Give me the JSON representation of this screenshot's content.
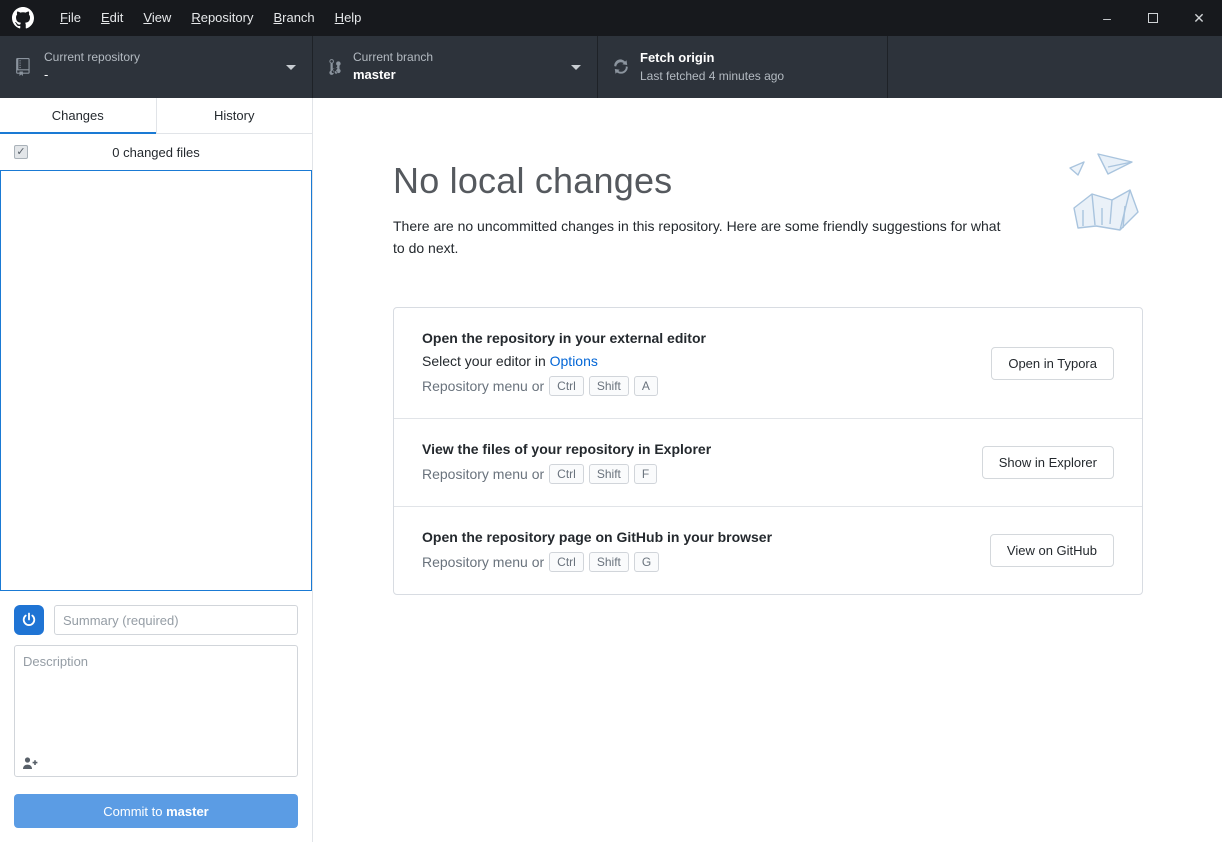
{
  "titlebar": {
    "menus": [
      "File",
      "Edit",
      "View",
      "Repository",
      "Branch",
      "Help"
    ],
    "window": {
      "minimize": "–",
      "close": "✕"
    }
  },
  "toolbar": {
    "repository": {
      "label": "Current repository",
      "value": "-"
    },
    "branch": {
      "label": "Current branch",
      "value": "master"
    },
    "fetch": {
      "title": "Fetch origin",
      "detail": "Last fetched 4 minutes ago"
    }
  },
  "sidebar": {
    "tabs": [
      {
        "label": "Changes"
      },
      {
        "label": "History"
      }
    ],
    "changed_files": "0 changed files",
    "checkbox_check": "✓",
    "summary_placeholder": "Summary (required)",
    "description_placeholder": "Description",
    "commit": {
      "prefix": "Commit to ",
      "branch": "master"
    }
  },
  "main": {
    "title": "No local changes",
    "subtitle": "There are no uncommitted changes in this repository. Here are some friendly suggestions for what to do next.",
    "suggestions": [
      {
        "title": "Open the repository in your external editor",
        "line_prefix": "Select your editor in ",
        "line_link": "Options",
        "shortcut_prefix": "Repository menu or",
        "keys": [
          "Ctrl",
          "Shift",
          "A"
        ],
        "button": "Open in Typora"
      },
      {
        "title": "View the files of your repository in Explorer",
        "shortcut_prefix": "Repository menu or",
        "keys": [
          "Ctrl",
          "Shift",
          "F"
        ],
        "button": "Show in Explorer"
      },
      {
        "title": "Open the repository page on GitHub in your browser",
        "shortcut_prefix": "Repository menu or",
        "keys": [
          "Ctrl",
          "Shift",
          "G"
        ],
        "button": "View on GitHub"
      }
    ]
  },
  "colors": {
    "accent_blue": "#1a7ad4",
    "link_blue": "#0366d6",
    "commit_button": "#5b9ce4",
    "titlebar_bg": "#17191d",
    "toolbar_bg": "#2d333b"
  }
}
